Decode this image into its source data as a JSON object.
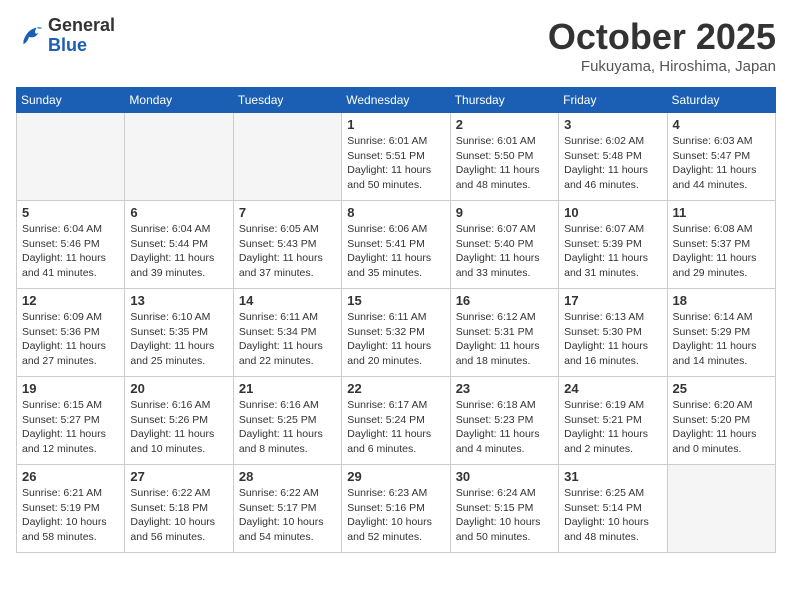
{
  "header": {
    "logo": {
      "general": "General",
      "blue": "Blue"
    },
    "month": "October 2025",
    "location": "Fukuyama, Hiroshima, Japan"
  },
  "weekdays": [
    "Sunday",
    "Monday",
    "Tuesday",
    "Wednesday",
    "Thursday",
    "Friday",
    "Saturday"
  ],
  "weeks": [
    [
      {
        "day": "",
        "info": ""
      },
      {
        "day": "",
        "info": ""
      },
      {
        "day": "",
        "info": ""
      },
      {
        "day": "1",
        "info": "Sunrise: 6:01 AM\nSunset: 5:51 PM\nDaylight: 11 hours\nand 50 minutes."
      },
      {
        "day": "2",
        "info": "Sunrise: 6:01 AM\nSunset: 5:50 PM\nDaylight: 11 hours\nand 48 minutes."
      },
      {
        "day": "3",
        "info": "Sunrise: 6:02 AM\nSunset: 5:48 PM\nDaylight: 11 hours\nand 46 minutes."
      },
      {
        "day": "4",
        "info": "Sunrise: 6:03 AM\nSunset: 5:47 PM\nDaylight: 11 hours\nand 44 minutes."
      }
    ],
    [
      {
        "day": "5",
        "info": "Sunrise: 6:04 AM\nSunset: 5:46 PM\nDaylight: 11 hours\nand 41 minutes."
      },
      {
        "day": "6",
        "info": "Sunrise: 6:04 AM\nSunset: 5:44 PM\nDaylight: 11 hours\nand 39 minutes."
      },
      {
        "day": "7",
        "info": "Sunrise: 6:05 AM\nSunset: 5:43 PM\nDaylight: 11 hours\nand 37 minutes."
      },
      {
        "day": "8",
        "info": "Sunrise: 6:06 AM\nSunset: 5:41 PM\nDaylight: 11 hours\nand 35 minutes."
      },
      {
        "day": "9",
        "info": "Sunrise: 6:07 AM\nSunset: 5:40 PM\nDaylight: 11 hours\nand 33 minutes."
      },
      {
        "day": "10",
        "info": "Sunrise: 6:07 AM\nSunset: 5:39 PM\nDaylight: 11 hours\nand 31 minutes."
      },
      {
        "day": "11",
        "info": "Sunrise: 6:08 AM\nSunset: 5:37 PM\nDaylight: 11 hours\nand 29 minutes."
      }
    ],
    [
      {
        "day": "12",
        "info": "Sunrise: 6:09 AM\nSunset: 5:36 PM\nDaylight: 11 hours\nand 27 minutes."
      },
      {
        "day": "13",
        "info": "Sunrise: 6:10 AM\nSunset: 5:35 PM\nDaylight: 11 hours\nand 25 minutes."
      },
      {
        "day": "14",
        "info": "Sunrise: 6:11 AM\nSunset: 5:34 PM\nDaylight: 11 hours\nand 22 minutes."
      },
      {
        "day": "15",
        "info": "Sunrise: 6:11 AM\nSunset: 5:32 PM\nDaylight: 11 hours\nand 20 minutes."
      },
      {
        "day": "16",
        "info": "Sunrise: 6:12 AM\nSunset: 5:31 PM\nDaylight: 11 hours\nand 18 minutes."
      },
      {
        "day": "17",
        "info": "Sunrise: 6:13 AM\nSunset: 5:30 PM\nDaylight: 11 hours\nand 16 minutes."
      },
      {
        "day": "18",
        "info": "Sunrise: 6:14 AM\nSunset: 5:29 PM\nDaylight: 11 hours\nand 14 minutes."
      }
    ],
    [
      {
        "day": "19",
        "info": "Sunrise: 6:15 AM\nSunset: 5:27 PM\nDaylight: 11 hours\nand 12 minutes."
      },
      {
        "day": "20",
        "info": "Sunrise: 6:16 AM\nSunset: 5:26 PM\nDaylight: 11 hours\nand 10 minutes."
      },
      {
        "day": "21",
        "info": "Sunrise: 6:16 AM\nSunset: 5:25 PM\nDaylight: 11 hours\nand 8 minutes."
      },
      {
        "day": "22",
        "info": "Sunrise: 6:17 AM\nSunset: 5:24 PM\nDaylight: 11 hours\nand 6 minutes."
      },
      {
        "day": "23",
        "info": "Sunrise: 6:18 AM\nSunset: 5:23 PM\nDaylight: 11 hours\nand 4 minutes."
      },
      {
        "day": "24",
        "info": "Sunrise: 6:19 AM\nSunset: 5:21 PM\nDaylight: 11 hours\nand 2 minutes."
      },
      {
        "day": "25",
        "info": "Sunrise: 6:20 AM\nSunset: 5:20 PM\nDaylight: 11 hours\nand 0 minutes."
      }
    ],
    [
      {
        "day": "26",
        "info": "Sunrise: 6:21 AM\nSunset: 5:19 PM\nDaylight: 10 hours\nand 58 minutes."
      },
      {
        "day": "27",
        "info": "Sunrise: 6:22 AM\nSunset: 5:18 PM\nDaylight: 10 hours\nand 56 minutes."
      },
      {
        "day": "28",
        "info": "Sunrise: 6:22 AM\nSunset: 5:17 PM\nDaylight: 10 hours\nand 54 minutes."
      },
      {
        "day": "29",
        "info": "Sunrise: 6:23 AM\nSunset: 5:16 PM\nDaylight: 10 hours\nand 52 minutes."
      },
      {
        "day": "30",
        "info": "Sunrise: 6:24 AM\nSunset: 5:15 PM\nDaylight: 10 hours\nand 50 minutes."
      },
      {
        "day": "31",
        "info": "Sunrise: 6:25 AM\nSunset: 5:14 PM\nDaylight: 10 hours\nand 48 minutes."
      },
      {
        "day": "",
        "info": ""
      }
    ]
  ]
}
